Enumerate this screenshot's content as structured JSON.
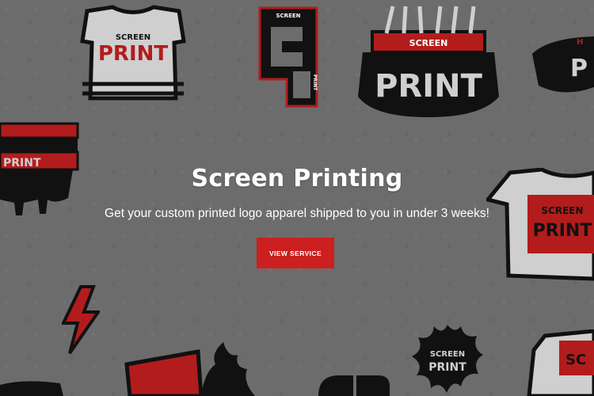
{
  "hero": {
    "title": "Screen Printing",
    "subtitle": "Get your custom printed logo apparel shipped to you in under 3 weeks!",
    "cta_label": "VIEW SERVICE"
  },
  "decor": {
    "tshirt_top_text_1": "SCREEN",
    "tshirt_top_text_2": "PRINT",
    "sp_logo_small": "SCREEN",
    "sp_logo_side": "PRINT",
    "squeegee_top_text_1": "SCREEN",
    "squeegee_top_text_2": "PRINT",
    "corner_text": "P",
    "corner_h": "H",
    "left_squeegee_text": "PRINT",
    "tshirt_right_text_1": "SCREEN",
    "tshirt_right_text_2": "PRINT",
    "splat_text_1": "SCREEN",
    "splat_text_2": "PRINT",
    "bottom_right_text": "SC"
  },
  "colors": {
    "background": "#6c6c6c",
    "accent_red": "#cc1f1f",
    "ink_black": "#111111",
    "shirt_grey": "#cfcfcf"
  }
}
